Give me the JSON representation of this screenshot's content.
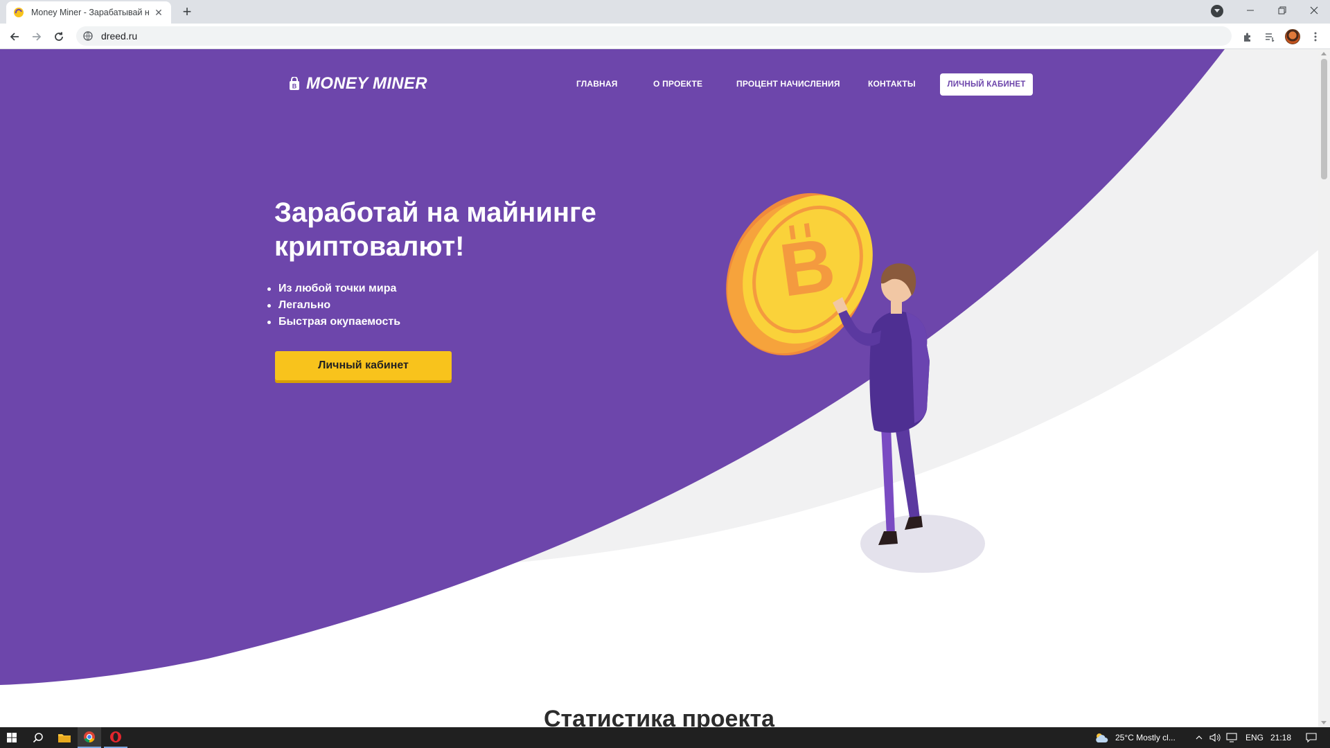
{
  "browser": {
    "tab_title": "Money Miner - Зарабатывай на",
    "url": "dreed.ru"
  },
  "site": {
    "logo_text": "MONEY MINER",
    "nav": {
      "home": "ГЛАВНАЯ",
      "about": "О ПРОЕКТЕ",
      "percent": "ПРОЦЕНТ НАЧИСЛЕНИЯ",
      "contacts": "КОНТАКТЫ",
      "cabinet": "ЛИЧНЫЙ КАБИНЕТ"
    },
    "hero": {
      "title": "Заработай на майнинге криптовалют!",
      "features": [
        "Из любой точки мира",
        "Легально",
        "Быстрая окупаемость"
      ],
      "button": "Личный кабинет"
    },
    "stats_title": "Статистика проекта",
    "colors": {
      "brand_purple": "#6d46ab",
      "accent_yellow": "#f8c31c",
      "light_gray": "#f1f1f2"
    }
  },
  "taskbar": {
    "weather": "25°C  Mostly cl...",
    "language": "ENG",
    "time": "21:18"
  }
}
